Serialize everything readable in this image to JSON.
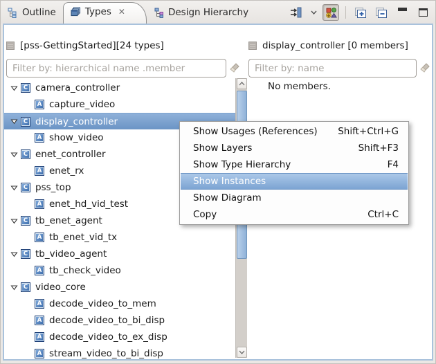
{
  "tabs": [
    {
      "label": "Outline",
      "active": false
    },
    {
      "label": "Types",
      "active": true,
      "closable": true,
      "close_glyph": "✕"
    },
    {
      "label": "Design Hierarchy",
      "active": false
    }
  ],
  "toolbar": {
    "buttons": [
      {
        "name": "filters-button",
        "icon": "filters-icon",
        "has_dropdown": true
      },
      {
        "name": "link-with-editor-button",
        "icon": "link-with-editor-icon",
        "pressed": true
      },
      {
        "name": "expand-all-button",
        "icon": "expand-all-icon"
      },
      {
        "name": "collapse-all-button",
        "icon": "collapse-all-icon"
      },
      {
        "name": "minimize-button",
        "icon": "minimize-icon"
      },
      {
        "name": "maximize-button",
        "icon": "maximize-icon"
      }
    ]
  },
  "left_panel": {
    "header": "[pss-GettingStarted][24 types]",
    "filter_placeholder": "Filter by: hierarchical name .member",
    "filter_value": "",
    "tree": [
      {
        "label": "camera_controller",
        "kind": "component",
        "selected": false
      },
      {
        "label": "capture_video",
        "kind": "action",
        "selected": false
      },
      {
        "label": "display_controller",
        "kind": "component",
        "selected": true
      },
      {
        "label": "show_video",
        "kind": "action",
        "selected": false
      },
      {
        "label": "enet_controller",
        "kind": "component",
        "selected": false
      },
      {
        "label": "enet_rx",
        "kind": "action",
        "selected": false
      },
      {
        "label": "pss_top",
        "kind": "component",
        "selected": false
      },
      {
        "label": "enet_hd_vid_test",
        "kind": "action",
        "selected": false
      },
      {
        "label": "tb_enet_agent",
        "kind": "component",
        "selected": false
      },
      {
        "label": "tb_enet_vid_tx",
        "kind": "action",
        "selected": false
      },
      {
        "label": "tb_video_agent",
        "kind": "component",
        "selected": false
      },
      {
        "label": "tb_check_video",
        "kind": "action",
        "selected": false
      },
      {
        "label": "video_core",
        "kind": "component",
        "selected": false
      },
      {
        "label": "decode_video_to_mem",
        "kind": "action",
        "selected": false
      },
      {
        "label": "decode_video_to_bi_disp",
        "kind": "action",
        "selected": false
      },
      {
        "label": "decode_video_to_ex_disp",
        "kind": "action",
        "selected": false
      },
      {
        "label": "stream_video_to_bi_disp",
        "kind": "action",
        "selected": false
      }
    ],
    "component_icon_letter": "C",
    "action_icon_letter": "A"
  },
  "right_panel": {
    "header": "display_controller [0 members]",
    "filter_placeholder": "Filter by: name",
    "filter_value": "",
    "empty_text": "No members."
  },
  "context_menu": {
    "items": [
      {
        "label": "Show Usages (References)",
        "shortcut": "Shift+Ctrl+G",
        "highlighted": false
      },
      {
        "label": "Show Layers",
        "shortcut": "Shift+F3",
        "highlighted": false
      },
      {
        "label": "Show Type Hierarchy",
        "shortcut": "F4",
        "highlighted": false
      },
      {
        "label": "Show Instances",
        "shortcut": "",
        "highlighted": true
      },
      {
        "label": "Show Diagram",
        "shortcut": "",
        "highlighted": false
      },
      {
        "label": "Copy",
        "shortcut": "Ctrl+C",
        "highlighted": false
      }
    ]
  },
  "colors": {
    "selection_top": "#8fb1d9",
    "selection_bottom": "#6b94c5",
    "menu_highlight_top": "#abc8e8",
    "menu_highlight_bottom": "#7ca4d3",
    "frame_border": "#a9c2dc",
    "tab_bar_bg": "#ebe8e5"
  }
}
